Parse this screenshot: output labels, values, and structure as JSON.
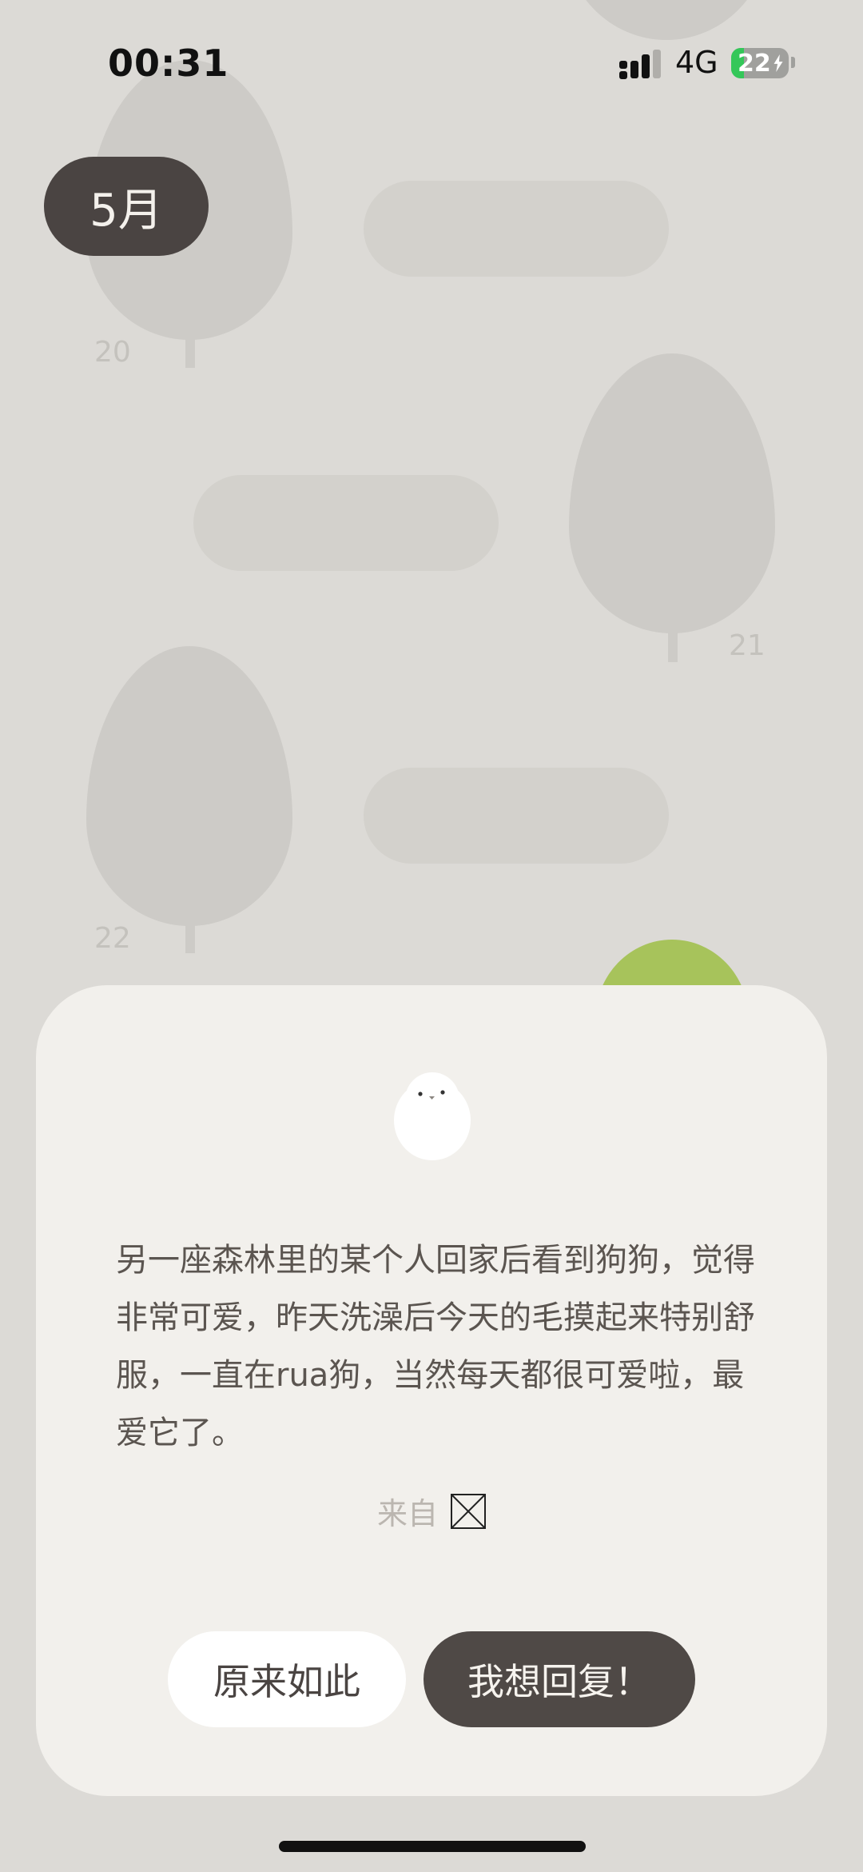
{
  "status_bar": {
    "time": "00:31",
    "network": "4G",
    "battery": "22",
    "battery_level": 0.22,
    "battery_color": "#34c759",
    "charging_icon": "bolt-icon",
    "signal_icon": "cellular-signal-icon"
  },
  "header": {
    "month": "5月"
  },
  "forest": {
    "days": [
      {
        "label": "20"
      },
      {
        "label": "21"
      },
      {
        "label": "22"
      }
    ]
  },
  "card": {
    "avatar_icon": "white-bird-icon",
    "message": "另一座森林里的某个人回家后看到狗狗，觉得非常可爱，昨天洗澡后今天的毛摸起来特别舒服，一直在rua狗，当然每天都很可爱啦，最爱它了。",
    "from_label": "来自",
    "from_icon": "missing-image-icon",
    "buttons": {
      "secondary": "原来如此",
      "primary": "我想回复！"
    }
  },
  "colors": {
    "background": "#dcdad6",
    "card": "#f2f0ec",
    "dark_accent": "#4a4442",
    "tree": "#cdcbc7",
    "green_tree": "#a7c35b"
  }
}
